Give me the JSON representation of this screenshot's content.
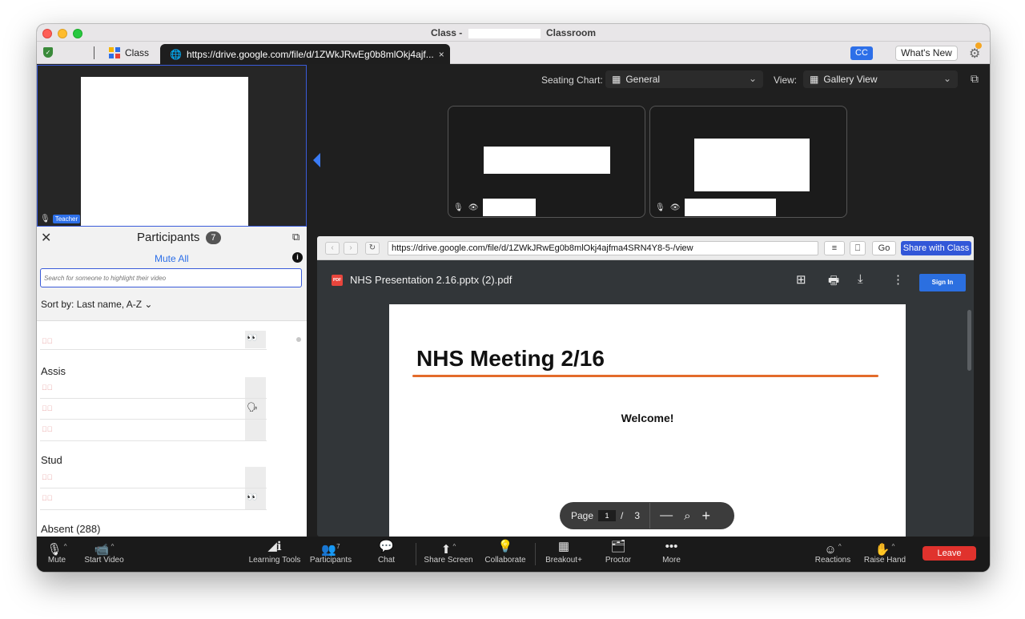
{
  "window": {
    "title_prefix": "Class -",
    "title_suffix": "Classroom"
  },
  "tabs": {
    "class_label": "Class",
    "url_tab_label": "https://drive.google.com/file/d/1ZWkJRwEg0b8mlOkj4ajf...",
    "close_glyph": "×"
  },
  "header_right": {
    "cc_label": "CC",
    "whats_new_label": "What's New"
  },
  "teacher": {
    "badge": "Teacher"
  },
  "view_controls": {
    "seating_label": "Seating Chart:",
    "seating_value": "General",
    "view_label": "View:",
    "view_value": "Gallery View"
  },
  "participants": {
    "title": "Participants",
    "count": "7",
    "mute_all": "Mute All",
    "search_placeholder": "Search for someone to highlight their video",
    "sort_label": "Sort by:",
    "sort_value": "Last name, A-Z",
    "groups": {
      "assistants": "Assis",
      "students": "Stud",
      "absent": "Absent (288)"
    }
  },
  "browser": {
    "url": "https://drive.google.com/file/d/1ZWkJRwEg0b8mlOkj4ajfma4SRN4Y8-5-/view",
    "go_label": "Go",
    "share_label": "Share with Class",
    "pdf_badge": "PDF",
    "pdf_name": "NHS Presentation 2.16.pptx (2).pdf",
    "sign_in": "Sign In",
    "slide_title": "NHS Meeting 2/16",
    "slide_subtitle": "Welcome!",
    "pager": {
      "label": "Page",
      "current": "1",
      "separator": "/",
      "total": "3"
    }
  },
  "toolbar": {
    "mute": "Mute",
    "start_video": "Start Video",
    "learning_tools": "Learning Tools",
    "participants": "Participants",
    "participants_count": "7",
    "chat": "Chat",
    "share_screen": "Share Screen",
    "collaborate": "Collaborate",
    "breakout": "Breakout+",
    "proctor": "Proctor",
    "more": "More",
    "reactions": "Reactions",
    "raise_hand": "Raise Hand",
    "leave": "Leave"
  },
  "colors": {
    "accent_blue": "#2d6fe8",
    "leave_red": "#e0322d",
    "slide_underline": "#e36b2b"
  }
}
